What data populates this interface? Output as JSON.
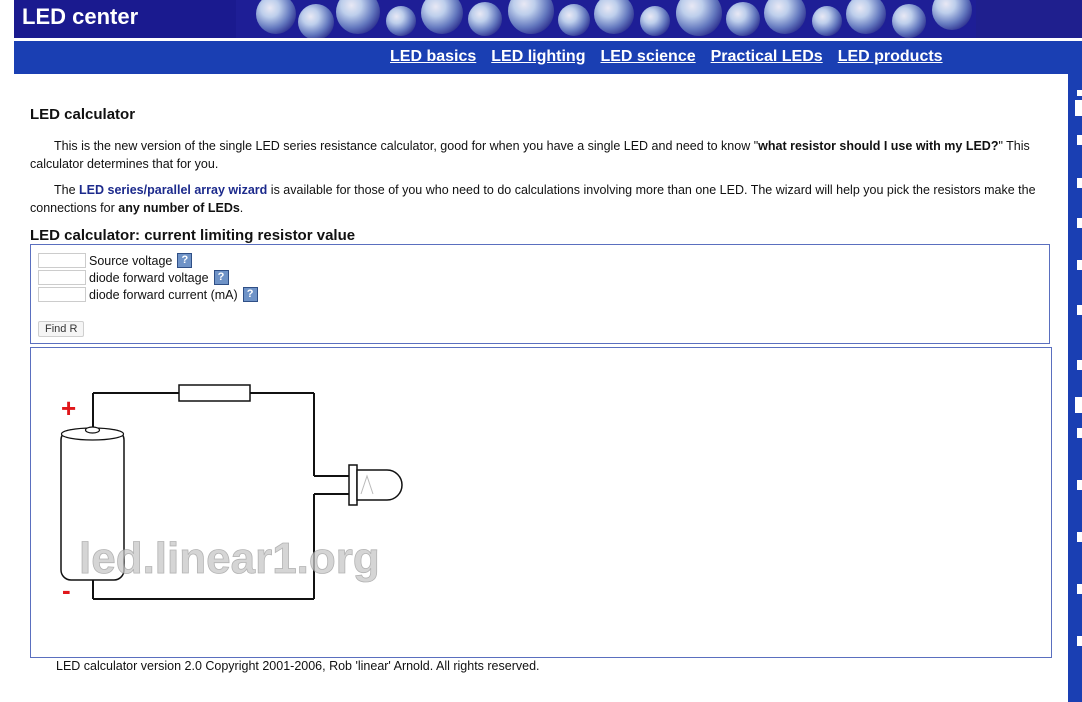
{
  "site": {
    "logo": "LED center"
  },
  "nav": {
    "items": [
      "LED basics",
      "LED lighting",
      "LED science",
      "Practical LEDs",
      "LED products"
    ]
  },
  "main": {
    "title": "LED calculator",
    "intro": {
      "text_before": "This is the new version of the single LED series resistance calculator, good for when you have a single LED and need to know \"",
      "bold": "what resistor should I use with my LED?",
      "text_after": "\" This calculator determines that for you."
    },
    "wizard": {
      "text_before": "The ",
      "link": "LED series/parallel array wizard",
      "text_mid": " is available for those of you who need to do calculations involving more than one LED. The wizard will help you pick the resistors make the connections for ",
      "bold": "any number of LEDs",
      "text_after": "."
    },
    "calc_title": "LED calculator: current limiting resistor value",
    "form": {
      "fields": [
        {
          "label": "Source voltage",
          "value": ""
        },
        {
          "label": "diode forward voltage",
          "value": ""
        },
        {
          "label": "diode forward current (mA)",
          "value": ""
        }
      ],
      "help_icon": "?",
      "button": "Find R"
    },
    "diagram": {
      "plus": "+",
      "minus": "-",
      "watermark": "led.linear1.org"
    },
    "footer": "LED calculator version 2.0 Copyright 2001-2006, Rob 'linear' Arnold. All rights reserved."
  },
  "colors": {
    "header_bg": "#1a1a8f",
    "nav_bg": "#1a3fb3",
    "link_blue": "#1c2a8c",
    "box_border": "#5a6fbf",
    "polarity_red": "#e0161a"
  }
}
